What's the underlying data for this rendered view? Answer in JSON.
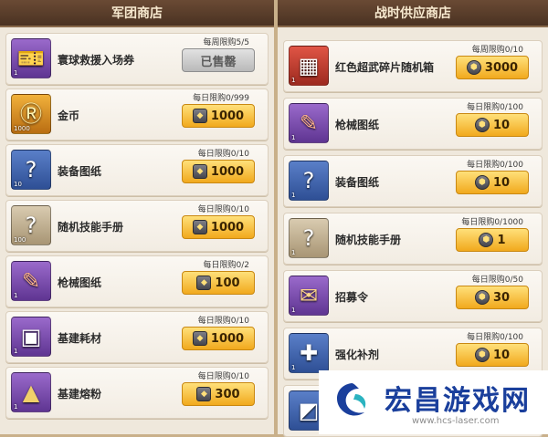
{
  "left_shop": {
    "title": "军团商店",
    "items": [
      {
        "name": "寰球救援入场券",
        "limit": "每周限购5/5",
        "action": "已售罄",
        "sold_out": true,
        "icon": "ticket-icon",
        "qty": "1"
      },
      {
        "name": "金币",
        "limit": "每日限购0/999",
        "action": "1000",
        "sold_out": false,
        "icon": "gold-coin-icon",
        "qty": "1000"
      },
      {
        "name": "装备图纸",
        "limit": "每日限购0/10",
        "action": "1000",
        "sold_out": false,
        "icon": "question-blueprint-icon",
        "qty": "10"
      },
      {
        "name": "随机技能手册",
        "limit": "每日限购0/10",
        "action": "1000",
        "sold_out": false,
        "icon": "question-scroll-icon",
        "qty": "100"
      },
      {
        "name": "枪械图纸",
        "limit": "每日限购0/2",
        "action": "100",
        "sold_out": false,
        "icon": "gun-blueprint-icon",
        "qty": "1"
      },
      {
        "name": "基建耗材",
        "limit": "每日限购0/10",
        "action": "1000",
        "sold_out": false,
        "icon": "materials-icon",
        "qty": "1"
      },
      {
        "name": "基建熔粉",
        "limit": "每日限购0/10",
        "action": "300",
        "sold_out": false,
        "icon": "powder-icon",
        "qty": "1"
      }
    ]
  },
  "right_shop": {
    "title": "战时供应商店",
    "items": [
      {
        "name": "红色超武碎片随机箱",
        "limit": "每周限购0/10",
        "action": "3000",
        "icon": "red-chest-icon",
        "qty": "1"
      },
      {
        "name": "枪械图纸",
        "limit": "每日限购0/100",
        "action": "10",
        "icon": "gun-blueprint-icon",
        "qty": "1"
      },
      {
        "name": "装备图纸",
        "limit": "每日限购0/100",
        "action": "10",
        "icon": "question-blueprint-icon",
        "qty": "1"
      },
      {
        "name": "随机技能手册",
        "limit": "每日限购0/1000",
        "action": "1",
        "icon": "question-scroll-icon",
        "qty": "1"
      },
      {
        "name": "招募令",
        "limit": "每日限购0/50",
        "action": "30",
        "icon": "recruit-order-icon",
        "qty": "1"
      },
      {
        "name": "强化补剂",
        "limit": "每日限购0/100",
        "action": "10",
        "icon": "syringe-icon",
        "qty": "1"
      },
      {
        "name": "",
        "limit": "",
        "action": "",
        "icon": "partial-item-icon",
        "qty": ""
      }
    ]
  },
  "watermark": {
    "title": "宏昌游戏网",
    "url": "www.hcs-laser.com"
  },
  "colors": {
    "buy_button": "#f1a91d",
    "sold_button": "#b9b9b9",
    "header": "#4a3222"
  }
}
